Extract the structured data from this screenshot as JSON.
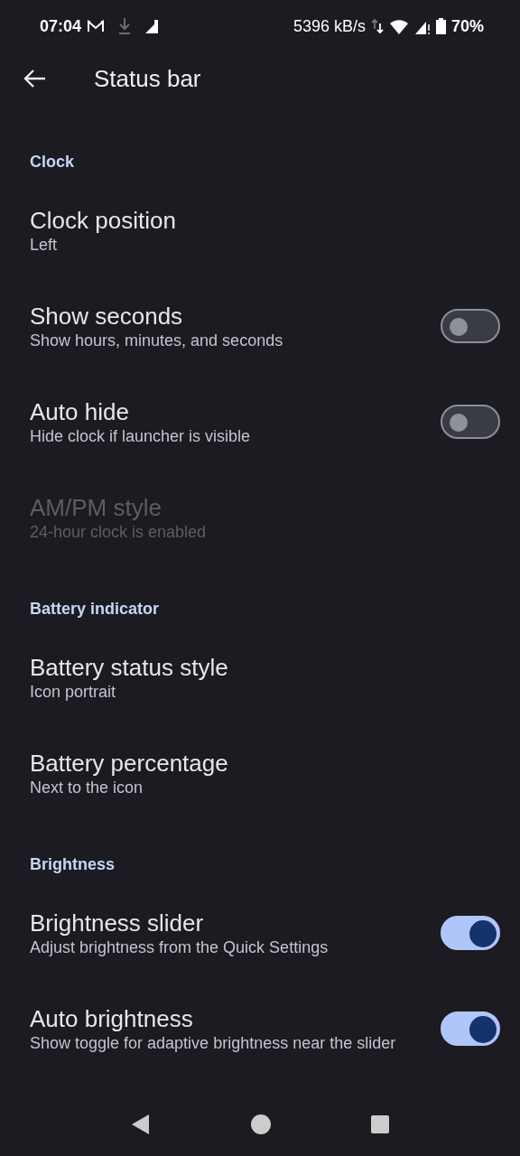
{
  "status_bar": {
    "time": "07:04",
    "speed": "5396 kB/s",
    "battery": "70%"
  },
  "app_bar": {
    "title": "Status bar"
  },
  "sections": [
    {
      "header": "Clock",
      "items": [
        {
          "kind": "plain",
          "title": "Clock position",
          "summary": "Left",
          "disabled": false
        },
        {
          "kind": "toggle",
          "title": "Show seconds",
          "summary": "Show hours, minutes, and seconds",
          "disabled": false,
          "on": false
        },
        {
          "kind": "toggle",
          "title": "Auto hide",
          "summary": "Hide clock if launcher is visible",
          "disabled": false,
          "on": false
        },
        {
          "kind": "plain",
          "title": "AM/PM style",
          "summary": "24-hour clock is enabled",
          "disabled": true
        }
      ]
    },
    {
      "header": "Battery indicator",
      "items": [
        {
          "kind": "plain",
          "title": "Battery status style",
          "summary": "Icon portrait",
          "disabled": false
        },
        {
          "kind": "plain",
          "title": "Battery percentage",
          "summary": "Next to the icon",
          "disabled": false
        }
      ]
    },
    {
      "header": "Brightness",
      "items": [
        {
          "kind": "toggle",
          "title": "Brightness slider",
          "summary": "Adjust brightness from the Quick Settings",
          "disabled": false,
          "on": true
        },
        {
          "kind": "toggle",
          "title": "Auto brightness",
          "summary": "Show toggle for adaptive brightness near the slider",
          "disabled": false,
          "on": true
        }
      ]
    }
  ]
}
